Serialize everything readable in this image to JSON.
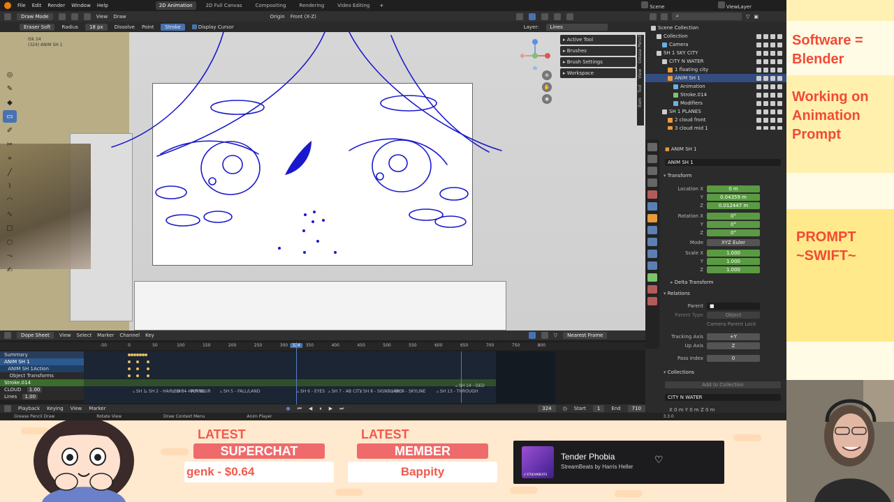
{
  "menu": [
    "File",
    "Edit",
    "Render",
    "Window",
    "Help"
  ],
  "workspaces": [
    "2D Animation",
    "2D Full Canvas",
    "Compositing",
    "Rendering",
    "Video Editing"
  ],
  "active_workspace": "2D Animation",
  "scene": "Scene",
  "view_layer": "ViewLayer",
  "viewport_header": {
    "mode": "Draw Mode",
    "view": "View",
    "draw": "Draw",
    "origin": "Origin",
    "projection": "Front (X-Z)",
    "brush": "Eraser Soft",
    "radius_label": "Radius",
    "radius_value": "18 px",
    "dissolve": "Dissolve",
    "point": "Point",
    "stroke": "Stroke",
    "display_cursor": "Display Cursor",
    "layer_label": "Layer:",
    "layer_value": "Lines"
  },
  "viewport_info": {
    "line1": "ISk 24",
    "line2": "(324) ANIM SH 1"
  },
  "tool_panel": [
    "Active Tool",
    "Brushes",
    "Brush Settings",
    "Workspace"
  ],
  "side_tabs": [
    "Item",
    "Tool",
    "View",
    "Grease Pencil"
  ],
  "dope": {
    "editor": "Dope Sheet",
    "menus": [
      "View",
      "Select",
      "Marker",
      "Channel",
      "Key"
    ],
    "snap": "Nearest Frame",
    "ruler": [
      "-50",
      "0",
      "50",
      "100",
      "150",
      "200",
      "250",
      "300",
      "324",
      "350",
      "400",
      "450",
      "500",
      "550",
      "600",
      "650",
      "700",
      "750",
      "800"
    ],
    "current_frame": "324",
    "channels": [
      "Summary",
      "ANIM SH 1",
      "ANIM SH 1Action",
      "Object Transforms",
      "Stroke.014",
      "CLOUD",
      "Lines"
    ],
    "channel_values": [
      "1.00",
      "1.00"
    ],
    "markers": [
      "SH 1",
      "SH 2 - HAIR/SH 3 - HAIR BLUR",
      "SH 4 - FLYING",
      "SH 5 - FALL/LAND",
      "SH 6 - EYES",
      "SH 7 - AB CITY",
      "SH 8 - SIGNBOARD",
      "SH 9 - SKYLINE",
      "SH 13 - THROUGH",
      "SH 14 - DED"
    ],
    "timeline": {
      "menus": [
        "Playback",
        "Keying",
        "View",
        "Marker"
      ],
      "frame": "324",
      "start_label": "Start",
      "start": "1",
      "end_label": "End",
      "end": "710"
    }
  },
  "statusbar": [
    "Grease Pencil Draw",
    "Rotate View",
    "Draw Context Menu",
    "Anim Player"
  ],
  "version": "3.3.0",
  "outliner": {
    "header": "Scene Collection",
    "rows": [
      {
        "label": "Scene Collection",
        "indent": 0,
        "sel": false,
        "color": "#cccccc"
      },
      {
        "label": "Collection",
        "indent": 1,
        "sel": false,
        "color": "#cccccc"
      },
      {
        "label": "Camera",
        "indent": 2,
        "sel": false,
        "color": "#6ab0e0"
      },
      {
        "label": "SH 1 SKY CITY",
        "indent": 1,
        "sel": false,
        "color": "#cccccc"
      },
      {
        "label": "CITY N WATER",
        "indent": 2,
        "sel": false,
        "color": "#cccccc"
      },
      {
        "label": "1 floating city",
        "indent": 3,
        "sel": false,
        "color": "#e89a3c"
      },
      {
        "label": "ANIM SH 1",
        "indent": 3,
        "sel": true,
        "color": "#e89a3c"
      },
      {
        "label": "Animation",
        "indent": 4,
        "sel": false,
        "color": "#6ab0e0"
      },
      {
        "label": "Stroke.014",
        "indent": 4,
        "sel": false,
        "color": "#7cc46a"
      },
      {
        "label": "Modifiers",
        "indent": 4,
        "sel": false,
        "color": "#6ab0e0"
      },
      {
        "label": "SH 1 PLANES",
        "indent": 2,
        "sel": false,
        "color": "#cccccc"
      },
      {
        "label": "2 cloud front",
        "indent": 3,
        "sel": false,
        "color": "#e89a3c"
      },
      {
        "label": "3 cloud mid 1",
        "indent": 3,
        "sel": false,
        "color": "#e89a3c"
      }
    ]
  },
  "properties": {
    "object_name": "ANIM SH 1",
    "object_field": "ANIM SH 1",
    "transform": "Transform",
    "location_label": "Location X",
    "location": [
      "0 m",
      "0.04359 m",
      "0.012447 m"
    ],
    "rotation_label": "Rotation X",
    "rotation": [
      "0°",
      "0°",
      "0°"
    ],
    "mode_label": "Mode",
    "mode": "XYZ Euler",
    "scale_label": "Scale X",
    "scale": [
      "1.000",
      "1.000",
      "1.000"
    ],
    "axis_y": "Y",
    "axis_z": "Z",
    "delta": "Delta Transform",
    "relations": "Relations",
    "parent_label": "Parent",
    "parent_type_label": "Parent Type",
    "parent_type": "Object",
    "camera_lock": "Camera Parent Lock",
    "tracking_label": "Tracking Axis",
    "tracking": "+Y",
    "up_label": "Up Axis",
    "up": "Z",
    "pass_label": "Pass Index",
    "pass": "0",
    "collections": "Collections",
    "add_collection": "Add to Collection",
    "collection_name": "CITY N WATER",
    "xyz": "X   0 m     Y   0 m     Z   0 m"
  },
  "overlay": {
    "line1": "Software =",
    "line2": "Blender",
    "line3": "Working on",
    "line4": "Animation",
    "line5": "Prompt",
    "line6": "PROMPT",
    "line7": "~SWIFT~",
    "latest1": "LATEST",
    "banner1": "SUPERCHAT",
    "ticker1": "genk - $0.64",
    "latest2": "LATEST",
    "banner2": "MEMBER",
    "ticker2": "Bappity",
    "song_title": "Tender Phobia",
    "song_artist": "StreamBeats by Harris Heller",
    "album_text": "// STREAMBEATS"
  },
  "colors": {
    "accent": "#4772b3",
    "overlay_red": "#f24a35",
    "ribbon": "#ef6a6a",
    "stroke_blue": "#1a1acc"
  }
}
